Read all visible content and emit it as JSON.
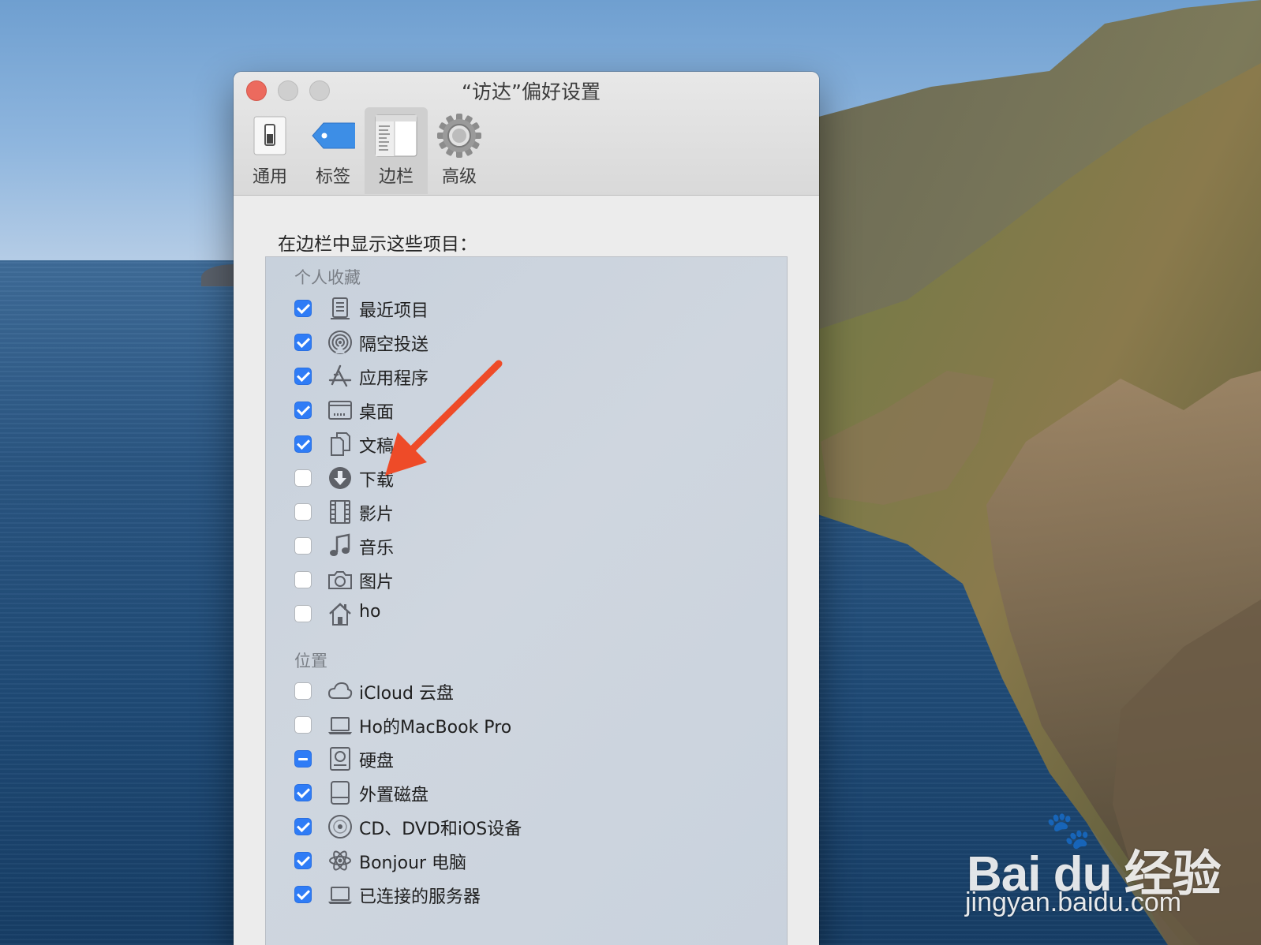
{
  "window": {
    "title": "“访达”偏好设置",
    "tabs": [
      {
        "label": "通用",
        "icon": "general-switch-icon",
        "selected": false
      },
      {
        "label": "标签",
        "icon": "tag-icon",
        "selected": false
      },
      {
        "label": "边栏",
        "icon": "sidebar-icon",
        "selected": true
      },
      {
        "label": "高级",
        "icon": "gear-icon",
        "selected": false
      }
    ]
  },
  "sidebar_prefs": {
    "heading": "在边栏中显示这些项目：",
    "favorites": {
      "label": "个人收藏",
      "items": [
        {
          "label": "最近项目",
          "icon": "recents-icon",
          "state": "checked"
        },
        {
          "label": "隔空投送",
          "icon": "airdrop-icon",
          "state": "checked"
        },
        {
          "label": "应用程序",
          "icon": "applications-icon",
          "state": "checked"
        },
        {
          "label": "桌面",
          "icon": "desktop-icon",
          "state": "checked"
        },
        {
          "label": "文稿",
          "icon": "documents-icon",
          "state": "checked"
        },
        {
          "label": "下载",
          "icon": "downloads-icon",
          "state": "unchecked"
        },
        {
          "label": "影片",
          "icon": "movies-icon",
          "state": "unchecked"
        },
        {
          "label": "音乐",
          "icon": "music-icon",
          "state": "unchecked"
        },
        {
          "label": "图片",
          "icon": "pictures-icon",
          "state": "unchecked"
        },
        {
          "label": "ho",
          "icon": "home-icon",
          "state": "unchecked"
        }
      ]
    },
    "locations": {
      "label": "位置",
      "items": [
        {
          "label": "iCloud 云盘",
          "icon": "icloud-icon",
          "state": "unchecked"
        },
        {
          "label": "Ho的MacBook Pro",
          "icon": "laptop-icon",
          "state": "unchecked"
        },
        {
          "label": "硬盘",
          "icon": "hard-disk-icon",
          "state": "mixed"
        },
        {
          "label": "外置磁盘",
          "icon": "external-disk-icon",
          "state": "checked"
        },
        {
          "label": "CD、DVD和iOS设备",
          "icon": "disc-icon",
          "state": "checked"
        },
        {
          "label": "Bonjour 电脑",
          "icon": "bonjour-icon",
          "state": "checked"
        },
        {
          "label": "已连接的服务器",
          "icon": "server-icon",
          "state": "checked"
        }
      ]
    }
  },
  "annotation": {
    "arrow_color": "#ee4b28",
    "points_to": "下载"
  },
  "watermark": {
    "brand": "Bai du 经验",
    "url": "jingyan.baidu.com"
  },
  "colors": {
    "checkbox_accent": "#2f7cf6",
    "close_button": "#ec6a5e"
  }
}
